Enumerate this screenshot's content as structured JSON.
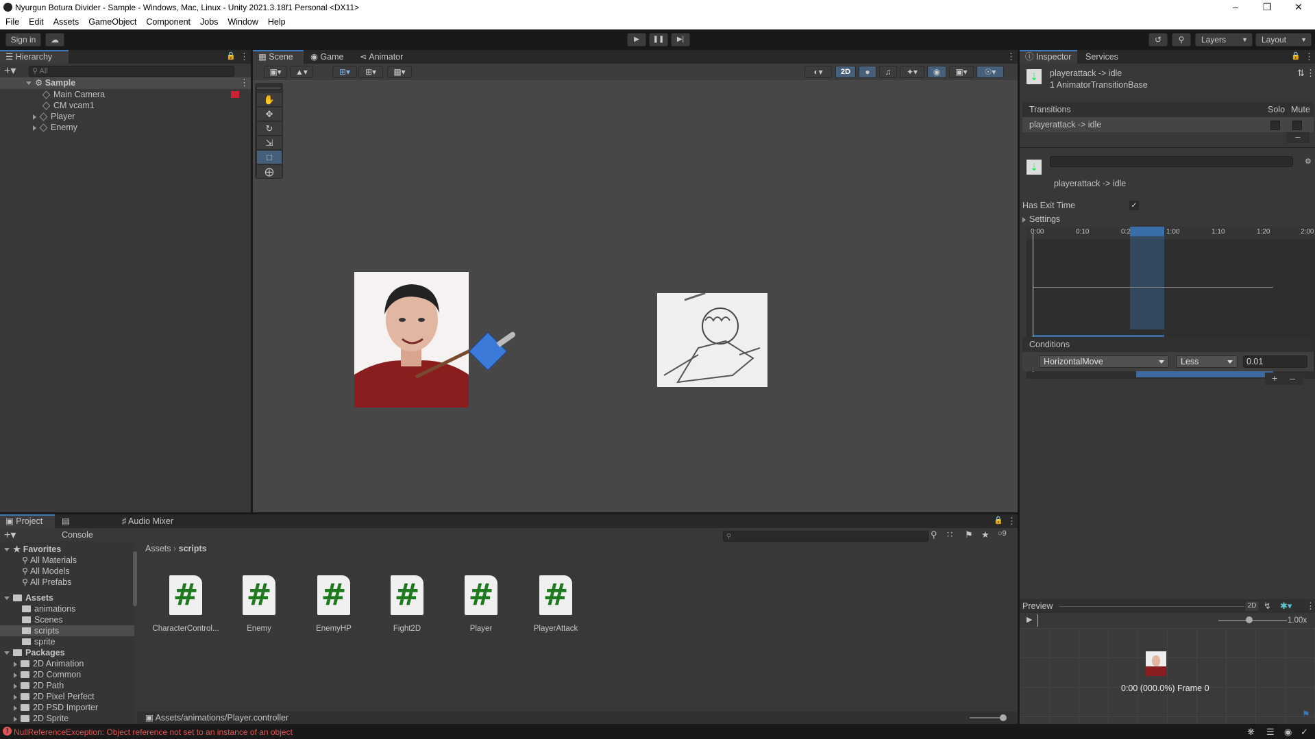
{
  "window": {
    "title": "Nyurgun Botura Divider - Sample - Windows, Mac, Linux - Unity 2021.3.18f1 Personal <DX11>"
  },
  "menu": [
    "File",
    "Edit",
    "Assets",
    "GameObject",
    "Component",
    "Jobs",
    "Window",
    "Help"
  ],
  "toolbar": {
    "sign_in": "Sign in",
    "layers": "Layers",
    "layout": "Layout"
  },
  "hierarchy": {
    "tab": "Hierarchy",
    "search_placeholder": "All",
    "scene": "Sample",
    "items": [
      "Main Camera",
      "CM vcam1",
      "Player",
      "Enemy"
    ]
  },
  "scene_tabs": [
    "Scene",
    "Game",
    "Animator"
  ],
  "scene_toolbar": {
    "mode_2d": "2D"
  },
  "inspector": {
    "tabs": [
      "Inspector",
      "Services"
    ],
    "header_title": "playerattack -> idle",
    "header_sub": "1 AnimatorTransitionBase",
    "transitions_label": "Transitions",
    "solo": "Solo",
    "mute": "Mute",
    "transition_item": "playerattack -> idle",
    "name_label": "playerattack -> idle",
    "has_exit_time": "Has Exit Time",
    "settings": "Settings",
    "timeline_ticks": [
      "0:00",
      "0:10",
      "0:20",
      "1:00",
      "1:10",
      "1:20",
      "2:00"
    ],
    "clip_from": "playerattack",
    "clip_to": "idle",
    "conditions_label": "Conditions",
    "condition": {
      "param": "HorizontalMove",
      "op": "Less",
      "value": "0.01"
    },
    "preview_label": "Preview",
    "preview_2d": "2D",
    "preview_speed": "1.00x",
    "preview_status": "0:00 (000.0%) Frame 0"
  },
  "project": {
    "tabs": [
      "Project",
      "Console",
      "Audio Mixer"
    ],
    "favorites_label": "Favorites",
    "favorites": [
      "All Materials",
      "All Models",
      "All Prefabs"
    ],
    "assets_label": "Assets",
    "asset_folders": [
      "animations",
      "Scenes",
      "scripts",
      "sprite"
    ],
    "packages_label": "Packages",
    "packages": [
      "2D Animation",
      "2D Common",
      "2D Path",
      "2D Pixel Perfect",
      "2D PSD Importer",
      "2D Sprite"
    ],
    "breadcrumb": [
      "Assets",
      "scripts"
    ],
    "files": [
      "CharacterControl...",
      "Enemy",
      "EnemyHP",
      "Fight2D",
      "Player",
      "PlayerAttack"
    ],
    "footer_path": "Assets/animations/Player.controller",
    "hidden_count": "9"
  },
  "status": {
    "error": "NullReferenceException: Object reference not set to an instance of an object",
    "error_color": "#e25353",
    "accent": "#3a79bb"
  }
}
